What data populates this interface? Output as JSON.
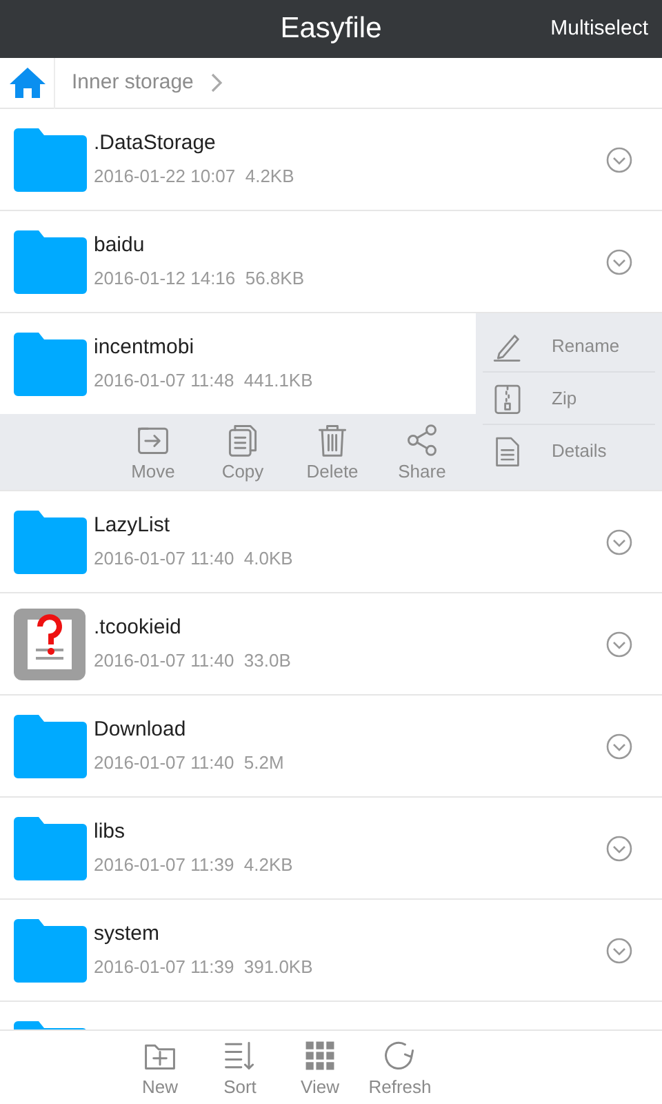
{
  "header": {
    "title": "Easyfile",
    "action": "Multiselect"
  },
  "breadcrumb": {
    "path": "Inner storage"
  },
  "files": [
    {
      "kind": "folder",
      "name": ".DataStorage",
      "date": "2016-01-22 10:07",
      "size": "4.2KB",
      "expanded": false
    },
    {
      "kind": "folder",
      "name": "baidu",
      "date": "2016-01-12 14:16",
      "size": "56.8KB",
      "expanded": false
    },
    {
      "kind": "folder",
      "name": "incentmobi",
      "date": "2016-01-07 11:48",
      "size": "441.1KB",
      "expanded": true,
      "actions": [
        {
          "kind": "move",
          "label": "Move"
        },
        {
          "kind": "copy",
          "label": "Copy"
        },
        {
          "kind": "delete",
          "label": "Delete"
        },
        {
          "kind": "share",
          "label": "Share"
        }
      ],
      "menu": [
        {
          "kind": "rename",
          "label": "Rename"
        },
        {
          "kind": "zip",
          "label": "Zip"
        },
        {
          "kind": "details",
          "label": "Details"
        }
      ]
    },
    {
      "kind": "folder",
      "name": "LazyList",
      "date": "2016-01-07 11:40",
      "size": "4.0KB",
      "expanded": false
    },
    {
      "kind": "unknown",
      "name": ".tcookieid",
      "date": "2016-01-07 11:40",
      "size": "33.0B",
      "expanded": false
    },
    {
      "kind": "folder",
      "name": "Download",
      "date": "2016-01-07 11:40",
      "size": "5.2M",
      "expanded": false
    },
    {
      "kind": "folder",
      "name": "libs",
      "date": "2016-01-07 11:39",
      "size": "4.2KB",
      "expanded": false
    },
    {
      "kind": "folder",
      "name": "system",
      "date": "2016-01-07 11:39",
      "size": "391.0KB",
      "expanded": false
    },
    {
      "kind": "folder"
    }
  ],
  "toolbar": [
    {
      "kind": "new",
      "label": "New"
    },
    {
      "kind": "sort",
      "label": "Sort"
    },
    {
      "kind": "view",
      "label": "View"
    },
    {
      "kind": "refresh",
      "label": "Refresh"
    }
  ]
}
